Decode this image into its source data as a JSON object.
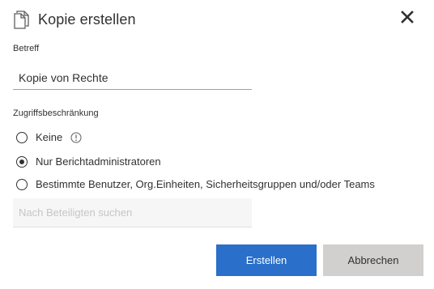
{
  "dialog": {
    "title": "Kopie erstellen",
    "title_icon": "copy-document-icon",
    "close_icon": "close-icon"
  },
  "subject": {
    "label": "Betreff",
    "value": "Kopie von Rechte"
  },
  "access": {
    "label": "Zugriffsbeschränkung",
    "options": [
      {
        "label": "Keine",
        "selected": false,
        "icon": "info-icon"
      },
      {
        "label": "Nur Berichtadministratoren",
        "selected": true
      },
      {
        "label": "Bestimmte Benutzer, Org.Einheiten, Sicherheitsgruppen und/oder Teams",
        "selected": false
      }
    ],
    "participants_placeholder": "Nach Beteiligten suchen"
  },
  "buttons": {
    "create_label": "Erstellen",
    "cancel_label": "Abbrechen"
  },
  "colors": {
    "primary": "#2a6fc9",
    "secondary": "#d2d0ce",
    "text": "#323130"
  }
}
